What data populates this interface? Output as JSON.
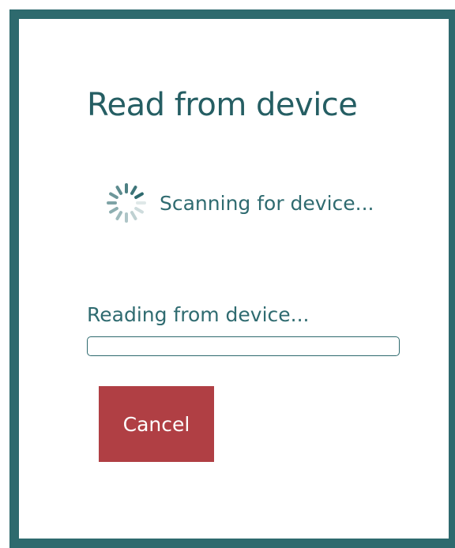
{
  "dialog": {
    "title": "Read from device",
    "scan_status": "Scanning for device...",
    "spinner_icon": "loading-spinner-icon",
    "progress": {
      "label": "Reading from device...",
      "fraction": 0
    },
    "cancel_label": "Cancel"
  },
  "colors": {
    "frame": "#2e6a6e",
    "title": "#255e63",
    "text": "#2f6b70",
    "cancel_button": "#b03f44"
  }
}
